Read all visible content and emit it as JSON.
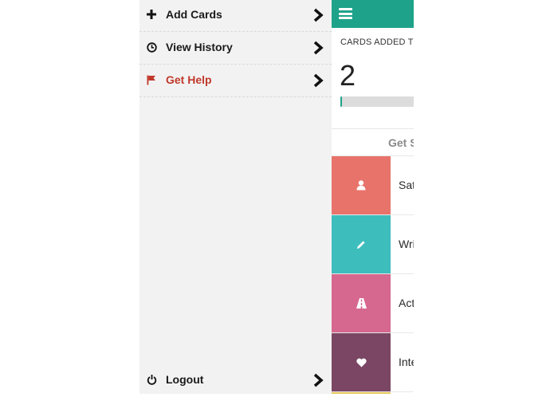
{
  "drawer": {
    "items": [
      {
        "label": "Add Cards",
        "icon": "plus-icon"
      },
      {
        "label": "View History",
        "icon": "clock-icon"
      },
      {
        "label": "Get Help",
        "icon": "flag-icon",
        "color": "#c0392b"
      }
    ],
    "logout": {
      "label": "Logout",
      "icon": "power-icon"
    }
  },
  "main": {
    "header_color": "#1ea38a",
    "cards_added_label": "CARDS ADDED TO",
    "cards_added_count": "2",
    "progress_fraction": 0.02,
    "section_title": "Get S",
    "cards": [
      {
        "label": "Sat",
        "color": "#e8736a",
        "icon": "person-icon"
      },
      {
        "label": "Wri",
        "color": "#3ebdbd",
        "icon": "pencil-icon"
      },
      {
        "label": "Act",
        "color": "#d6688f",
        "icon": "road-icon"
      },
      {
        "label": "Inte",
        "color": "#7a4663",
        "icon": "heart-icon"
      }
    ]
  }
}
